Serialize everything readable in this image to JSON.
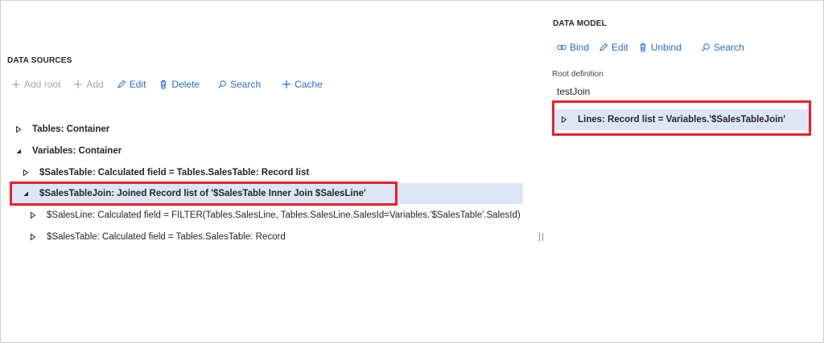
{
  "data_sources": {
    "title": "DATA SOURCES",
    "toolbar": {
      "add_root": "Add root",
      "add": "Add",
      "edit": "Edit",
      "delete": "Delete",
      "search": "Search",
      "cache": "Cache"
    },
    "tree": [
      {
        "label": "Tables: Container",
        "expanded": false
      },
      {
        "label": "Variables: Container",
        "expanded": true
      },
      {
        "label": "$SalesTable: Calculated field = Tables.SalesTable: Record list",
        "expanded": false
      },
      {
        "label": "$SalesTableJoin: Joined Record list of '$SalesTable Inner Join $SalesLine'",
        "expanded": true,
        "selected": true
      },
      {
        "label": "$SalesLine: Calculated field = FILTER(Tables.SalesLine, Tables.SalesLine.SalesId=Variables.'$SalesTable'.SalesId)",
        "expanded": false
      },
      {
        "label": "$SalesTable: Calculated field = Tables.SalesTable: Record",
        "expanded": false
      }
    ]
  },
  "data_model": {
    "title": "DATA MODEL",
    "toolbar": {
      "bind": "Bind",
      "edit": "Edit",
      "unbind": "Unbind",
      "search": "Search"
    },
    "root_definition_label": "Root definition",
    "root_definition_value": "testJoin",
    "tree": [
      {
        "label": "Lines: Record list = Variables.'$SalesTableJoin'",
        "expanded": false,
        "selected": true
      }
    ]
  },
  "colors": {
    "accent": "#2b6cc4",
    "highlight": "#e8202b",
    "selection": "#dde6f7",
    "disabled": "#a6a6a6"
  }
}
